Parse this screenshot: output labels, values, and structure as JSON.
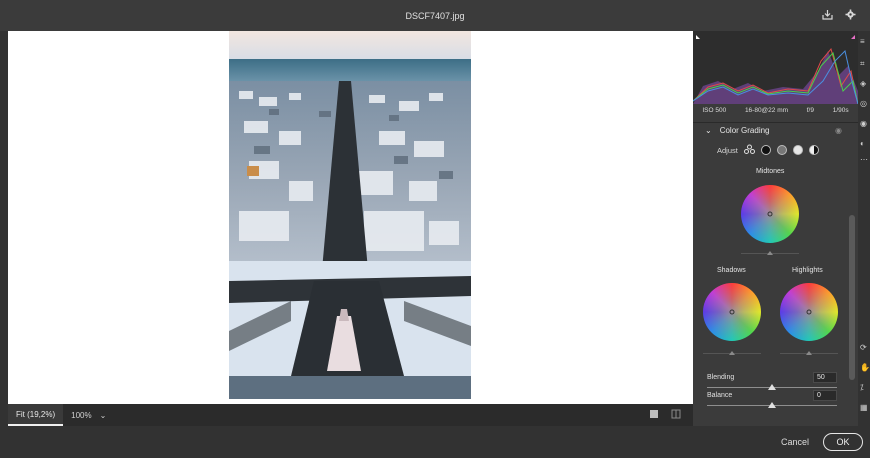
{
  "window": {
    "title": "DSCF7407.jpg",
    "icons": [
      "download-icon",
      "gear-icon"
    ]
  },
  "metadata": {
    "iso": "ISO 500",
    "lens": "16-80@22 mm",
    "aperture": "f/9",
    "shutter": "1/90s"
  },
  "color_grading": {
    "section_title": "Color Grading",
    "adjust_label": "Adjust",
    "midtones_label": "Midtones",
    "shadows_label": "Shadows",
    "highlights_label": "Highlights",
    "blending_label": "Blending",
    "blending_value": "50",
    "balance_label": "Balance",
    "balance_value": "0"
  },
  "status": {
    "fit_label": "Fit (19,2%)",
    "zoom_label": "100%"
  },
  "footer": {
    "cancel_label": "Cancel",
    "ok_label": "OK"
  },
  "colors": {
    "panel_bg": "#3b3b3b",
    "canvas_bg": "#ffffff",
    "accent": "#e6e6e6"
  }
}
